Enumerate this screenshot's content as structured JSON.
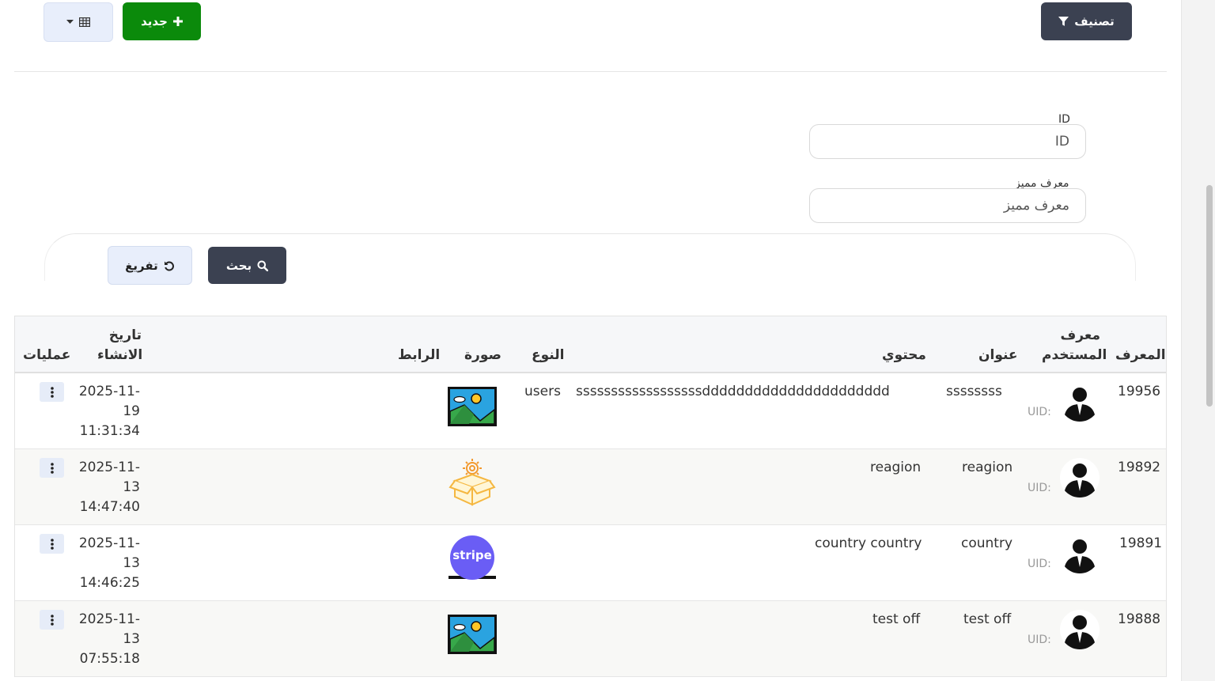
{
  "toolbar": {
    "filter_label": "تصنيف",
    "new_label": "جديد"
  },
  "filters": {
    "id_label": "ID",
    "id_placeholder": "ID",
    "slug_label": "معرف مميز",
    "slug_placeholder": "معرف مميز",
    "search_label": "بحث",
    "reset_label": "تفريغ"
  },
  "table": {
    "headers": {
      "id": "المعرف",
      "user_id": "معرف المستخدم",
      "title": "عنوان",
      "content": "محتوي",
      "type": "النوع",
      "image": "صورة",
      "link": "الرابط",
      "created": "تاريخ الانشاء",
      "actions": "عمليات"
    },
    "uid_label": "UID:",
    "rows": [
      {
        "id": "19956",
        "title": "ssssssss",
        "content": "ssssssssssssssssssdddddddddddddddddddddd",
        "type": "users",
        "image": "landscape",
        "date": "2025-11-",
        "date2": "19",
        "time": "11:31:34"
      },
      {
        "id": "19892",
        "title": "reagion",
        "content": "reagion",
        "type": "",
        "image": "box-gear",
        "date": "2025-11-",
        "date2": "13",
        "time": "14:47:40"
      },
      {
        "id": "19891",
        "title": "country",
        "content": "country country",
        "type": "",
        "image": "stripe",
        "date": "2025-11-",
        "date2": "13",
        "time": "14:46:25"
      },
      {
        "id": "19888",
        "title": "test off",
        "content": "test off",
        "type": "",
        "image": "landscape",
        "date": "2025-11-",
        "date2": "13",
        "time": "07:55:18"
      }
    ],
    "stripe_text": "stripe"
  }
}
